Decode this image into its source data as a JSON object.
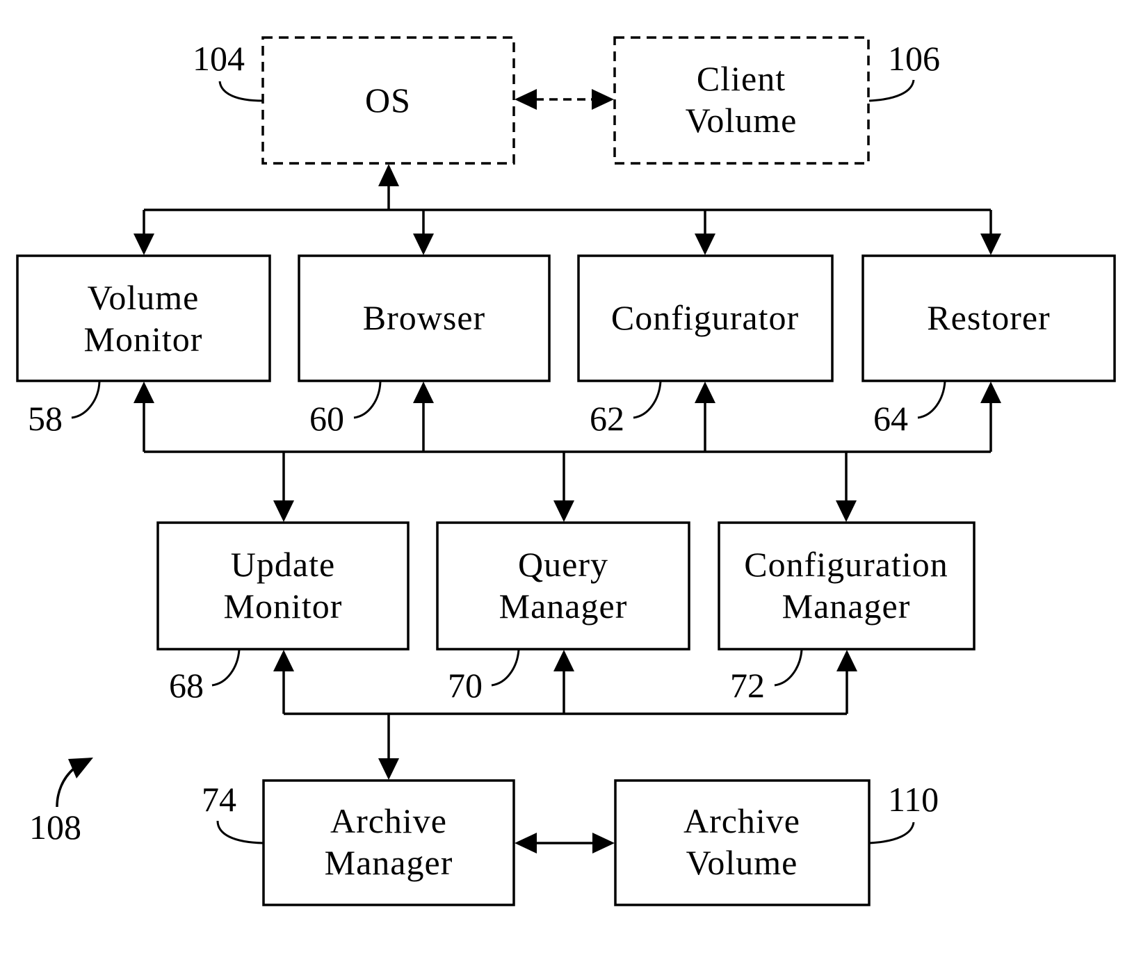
{
  "diagram": {
    "type": "block diagram",
    "blocks": {
      "os": {
        "lines": [
          "OS"
        ],
        "ref": "104",
        "style": "dashed"
      },
      "client_volume": {
        "lines": [
          "Client",
          "Volume"
        ],
        "ref": "106",
        "style": "dashed"
      },
      "volume_monitor": {
        "lines": [
          "Volume",
          "Monitor"
        ],
        "ref": "58"
      },
      "browser": {
        "lines": [
          "Browser"
        ],
        "ref": "60"
      },
      "configurator": {
        "lines": [
          "Configurator"
        ],
        "ref": "62"
      },
      "restorer": {
        "lines": [
          "Restorer"
        ],
        "ref": "64"
      },
      "update_monitor": {
        "lines": [
          "Update",
          "Monitor"
        ],
        "ref": "68"
      },
      "query_manager": {
        "lines": [
          "Query",
          "Manager"
        ],
        "ref": "70"
      },
      "configuration_manager": {
        "lines": [
          "Configuration",
          "Manager"
        ],
        "ref": "72"
      },
      "archive_manager": {
        "lines": [
          "Archive",
          "Manager"
        ],
        "ref": "74"
      },
      "archive_volume": {
        "lines": [
          "Archive",
          "Volume"
        ],
        "ref": "110"
      }
    },
    "figure_ref": "108",
    "connections": [
      {
        "from": "os",
        "to": "client_volume",
        "direction": "bidirectional",
        "style": "dashed"
      },
      {
        "from": "top_bus",
        "to": "os",
        "direction": "up"
      },
      {
        "from": "top_bus",
        "to": [
          "volume_monitor",
          "browser",
          "configurator",
          "restorer"
        ],
        "direction": "down"
      },
      {
        "from": "middle_bus",
        "to": [
          "volume_monitor",
          "browser",
          "configurator",
          "restorer"
        ],
        "direction": "up"
      },
      {
        "from": "middle_bus",
        "to": [
          "update_monitor",
          "query_manager",
          "configuration_manager"
        ],
        "direction": "down"
      },
      {
        "from": "bottom_bus",
        "to": [
          "update_monitor",
          "query_manager",
          "configuration_manager"
        ],
        "direction": "up"
      },
      {
        "from": "bottom_bus",
        "to": "archive_manager",
        "direction": "down"
      },
      {
        "from": "archive_manager",
        "to": "archive_volume",
        "direction": "bidirectional"
      }
    ]
  }
}
